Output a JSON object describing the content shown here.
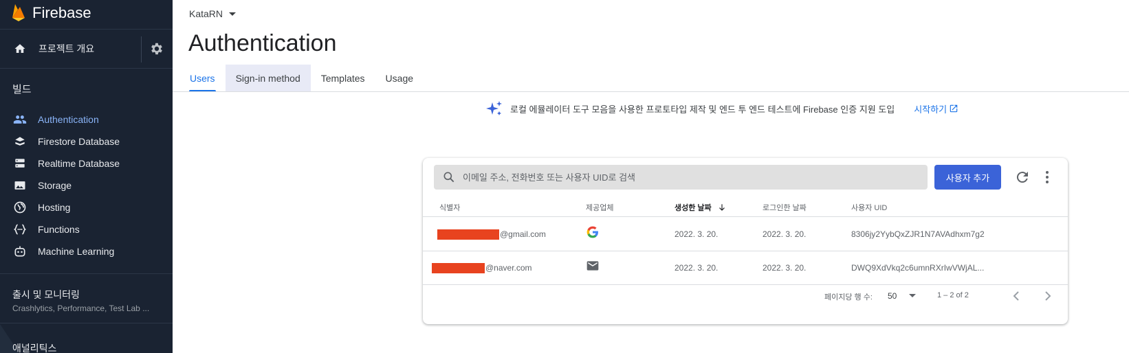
{
  "app": {
    "brand": "Firebase"
  },
  "sidebar": {
    "overview_label": "프로젝트 개요",
    "build_title": "빌드",
    "items": [
      {
        "label": "Authentication",
        "icon": "people-icon",
        "active": true
      },
      {
        "label": "Firestore Database",
        "icon": "firestore-icon"
      },
      {
        "label": "Realtime Database",
        "icon": "database-icon"
      },
      {
        "label": "Storage",
        "icon": "image-icon"
      },
      {
        "label": "Hosting",
        "icon": "globe-icon"
      },
      {
        "label": "Functions",
        "icon": "functions-icon"
      },
      {
        "label": "Machine Learning",
        "icon": "robot-icon"
      }
    ],
    "release_title": "출시 및 모니터링",
    "release_sub": "Crashlytics, Performance, Test Lab ...",
    "analytics_title": "애널리틱스"
  },
  "header": {
    "project": "KataRN",
    "title": "Authentication",
    "tabs": [
      "Users",
      "Sign-in method",
      "Templates",
      "Usage"
    ]
  },
  "banner": {
    "text": "로컬 에뮬레이터 도구 모음을 사용한 프로토타입 제작 및 엔드 투 엔드 테스트에 Firebase 인증 지원 도입",
    "link": "시작하기"
  },
  "users": {
    "search_placeholder": "이메일 주소, 전화번호 또는 사용자 UID로 검색",
    "add_button": "사용자 추가",
    "columns": [
      "식별자",
      "제공업체",
      "생성한 날짜",
      "로그인한 날짜",
      "사용자 UID"
    ],
    "rows": [
      {
        "identifier": "@gmail.com",
        "provider": "google-icon",
        "created": "2022. 3. 20.",
        "signed_in": "2022. 3. 20.",
        "uid": "8306jy2YybQxZJR1N7AVAdhxm7g2"
      },
      {
        "identifier": "@naver.com",
        "provider": "email-icon",
        "created": "2022. 3. 20.",
        "signed_in": "2022. 3. 20.",
        "uid": "DWQ9XdVkq2c6umnRXrIwVWjAL..."
      }
    ],
    "rows_per_page_label": "페이지당 행 수:",
    "rows_per_page": "50",
    "range": "1 – 2 of 2"
  },
  "colors": {
    "sidebar_bg": "#1a2332",
    "accent": "#1a73e8",
    "button": "#3b63d8",
    "redaction": "#e8431f"
  }
}
